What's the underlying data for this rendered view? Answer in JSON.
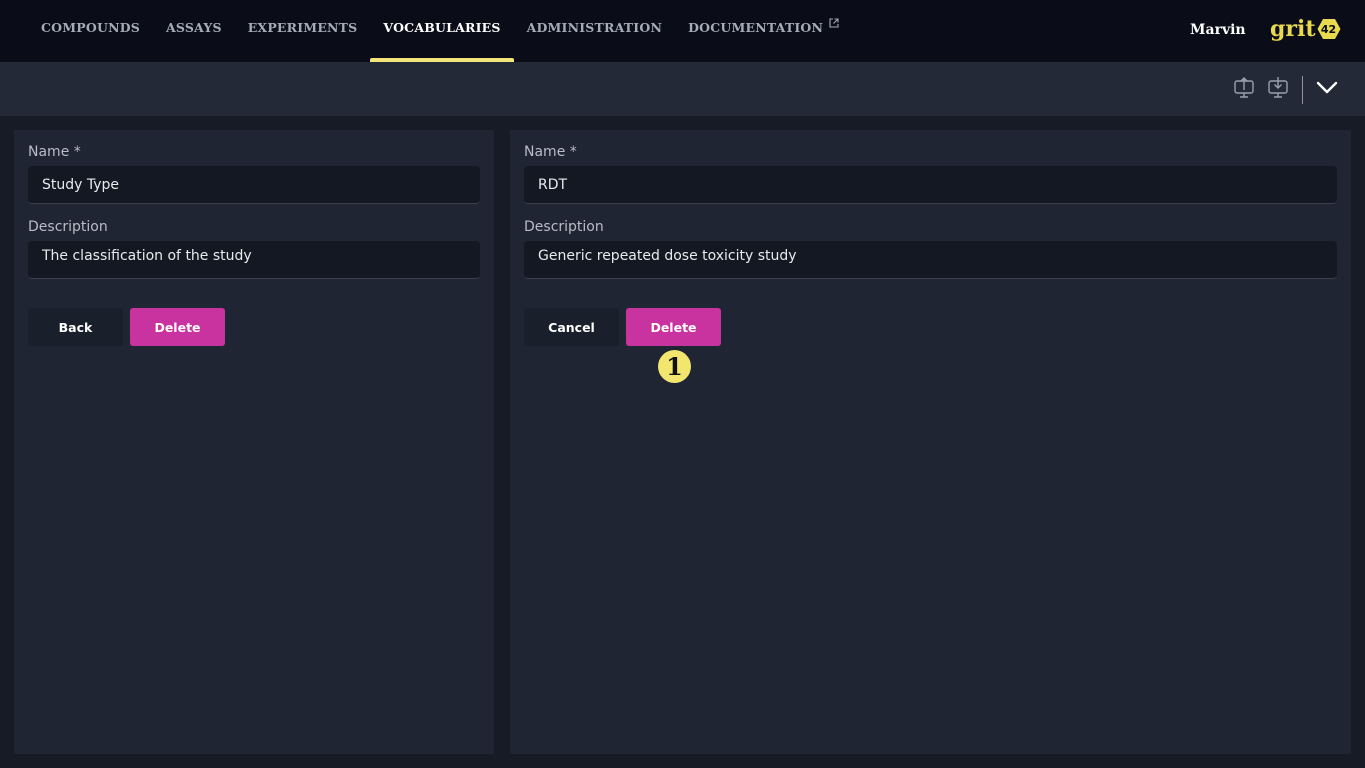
{
  "nav": {
    "items": [
      {
        "label": "COMPOUNDS",
        "active": false
      },
      {
        "label": "ASSAYS",
        "active": false
      },
      {
        "label": "EXPERIMENTS",
        "active": false
      },
      {
        "label": "VOCABULARIES",
        "active": true
      },
      {
        "label": "ADMINISTRATION",
        "active": false
      },
      {
        "label": "DOCUMENTATION",
        "active": false,
        "external": true
      }
    ]
  },
  "user": {
    "name": "Marvin"
  },
  "logo": {
    "text": "grit",
    "badge": "42"
  },
  "toolbar": {
    "icons": [
      "upload-icon",
      "download-icon",
      "chevron-down-icon"
    ]
  },
  "vocabulary_form": {
    "name_label": "Name *",
    "name_value": "Study Type",
    "description_label": "Description",
    "description_value": "The classification of the study",
    "back_label": "Back",
    "delete_label": "Delete"
  },
  "item_form": {
    "name_label": "Name *",
    "name_value": "RDT",
    "description_label": "Description",
    "description_value": "Generic repeated dose toxicity study",
    "cancel_label": "Cancel",
    "delete_label": "Delete"
  },
  "annotation": {
    "marker": "1"
  },
  "colors": {
    "topbar_bg": "#0a0c18",
    "toolbar_bg": "#232937",
    "panel_bg": "#1f2533",
    "input_bg": "#141822",
    "accent_yellow": "#f3e57a",
    "primary_button": "#c8339f"
  }
}
